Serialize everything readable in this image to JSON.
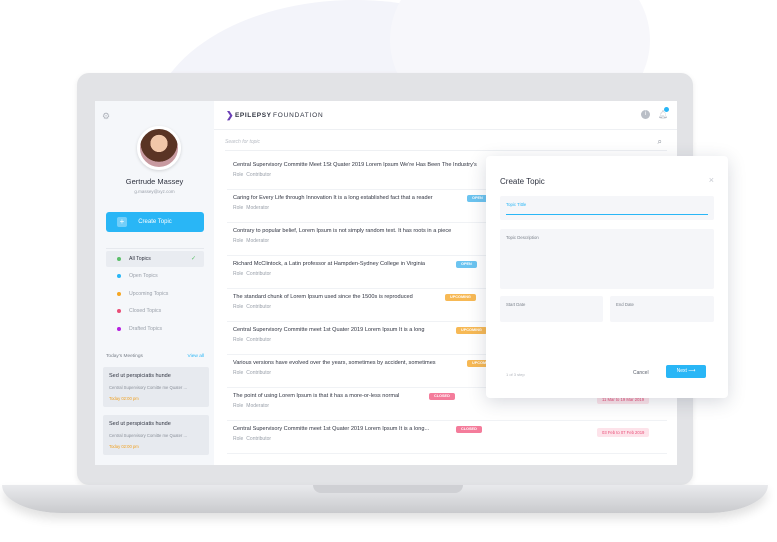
{
  "brand": {
    "mark": "❯",
    "name_bold": "EPILEPSY",
    "name_light": "FOUNDATION"
  },
  "user": {
    "name": "Gertrude Massey",
    "email": "g.massey@xyz.com"
  },
  "sidebar": {
    "create_label": "Create Topic",
    "filters": [
      {
        "label": "All Topics",
        "color": "#5bbf6a",
        "active": true
      },
      {
        "label": "Open Topics",
        "color": "#29b6f6"
      },
      {
        "label": "Upcoming Topics",
        "color": "#f5a623"
      },
      {
        "label": "Closed Topics",
        "color": "#e94e77"
      },
      {
        "label": "Drafted Topics",
        "color": "#b620e0"
      }
    ],
    "meetings_heading": "Today's Meetings",
    "view_all": "View all",
    "meetings": [
      {
        "title": "Sed ut perspiciatis hunde",
        "desc": "Central Supervisory Comitte me Quater ...",
        "time": "Today  02:00 pm"
      },
      {
        "title": "Sed ut perspiciatis hunde",
        "desc": "Central Supervisory Comitte me Quater ...",
        "time": "Today  02:00 pm"
      }
    ]
  },
  "search": {
    "placeholder": "Search for topic"
  },
  "topics": [
    {
      "title": "Central Supervisory Committe Meet 1St Quater 2019 Lorem Ipsum We're Has Been The Industry's",
      "role_label": "Role",
      "role": "Contributor",
      "badge": "",
      "badge_color": "",
      "date": ""
    },
    {
      "title": "Caring for Every Life through Innovation It is a long established fact that a reader",
      "role_label": "Role",
      "role": "Moderator",
      "badge": "OPEN",
      "badge_color": "#6cc4f0",
      "date": ""
    },
    {
      "title": "Contrary to popular belief, Lorem Ipsum is not simply random text. It has roots in a piece",
      "role_label": "Role",
      "role": "Moderator",
      "badge": "",
      "badge_color": "",
      "date": ""
    },
    {
      "title": "Richard McClintock, a Latin professor at Hampden-Sydney College in Virginia",
      "role_label": "Role",
      "role": "Contributor",
      "badge": "OPEN",
      "badge_color": "#6cc4f0",
      "date": ""
    },
    {
      "title": "The standard chunk of Lorem Ipsum used since the 1500s is reproduced",
      "role_label": "Role",
      "role": "Contributor",
      "badge": "UPCOMING",
      "badge_color": "#f7b955",
      "date": ""
    },
    {
      "title": "Central Supervisory Committe meet 1st Quater 2019 Lorem Ipsum It is a long",
      "role_label": "Role",
      "role": "Contributor",
      "badge": "UPCOMING",
      "badge_color": "#f7b955",
      "date": ""
    },
    {
      "title": "Various versions have evolved over the years, sometimes by accident, sometimes",
      "role_label": "Role",
      "role": "Contributor",
      "badge": "UPCOMING",
      "badge_color": "#f7b955",
      "date": ""
    },
    {
      "title": "The point of using Lorem Ipsum is that it has a more-or-less normal",
      "role_label": "Role",
      "role": "Moderator",
      "badge": "CLOSED",
      "badge_color": "#f47c9b",
      "date": "11 Mar to 19 Mar 2019"
    },
    {
      "title": "Central Supervisory Committe meet 1st Quater 2019 Lorem Ipsum It is a long...",
      "role_label": "Role",
      "role": "Contributor",
      "badge": "CLOSED",
      "badge_color": "#f47c9b",
      "date": "03 Feb to 07 Feb 2019"
    }
  ],
  "modal": {
    "title": "Create Topic",
    "close": "×",
    "topic_title_label": "Topic Tittle",
    "topic_desc_label": "Topic Description",
    "start_label": "Start Date",
    "end_label": "End Date",
    "pages": "1 of 3 step",
    "cancel": "Cancel",
    "next": "Next  ⟶"
  }
}
